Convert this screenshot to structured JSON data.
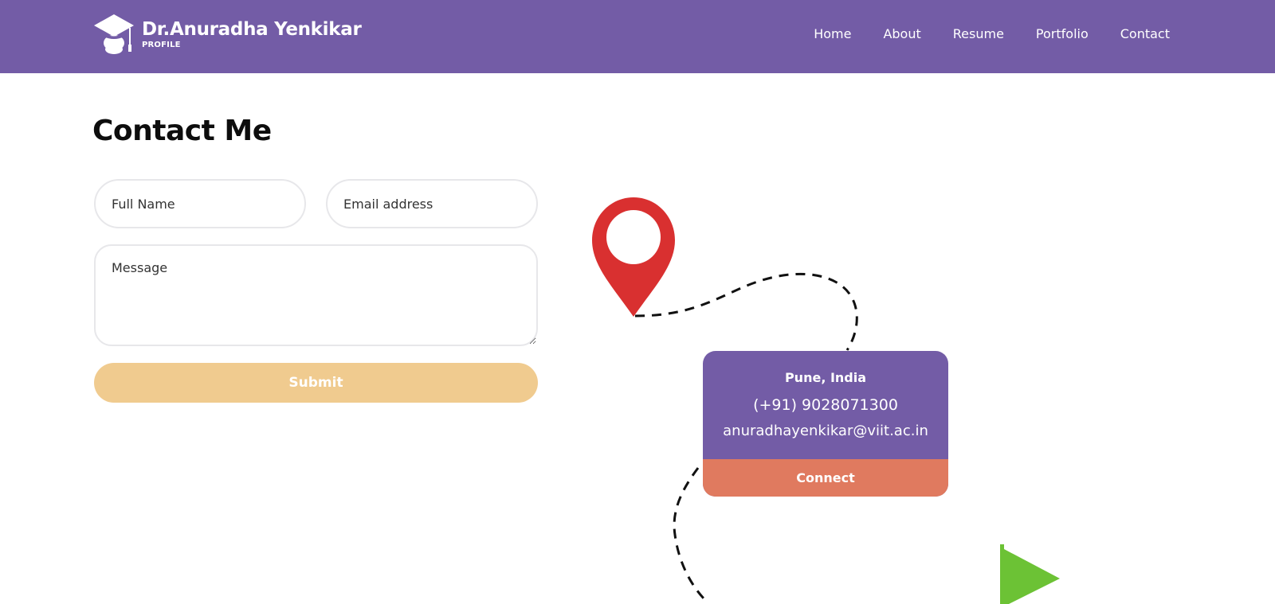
{
  "header": {
    "brand_title": "Dr.Anuradha Yenkikar",
    "brand_subtitle": "PROFILE",
    "logo_icon": "graduation-cap-icon",
    "background_color": "#735ca6",
    "nav": [
      {
        "label": "Home"
      },
      {
        "label": "About"
      },
      {
        "label": "Resume"
      },
      {
        "label": "Portfolio"
      },
      {
        "label": "Contact"
      }
    ]
  },
  "main": {
    "title": "Contact Me",
    "form": {
      "full_name_placeholder": "Full Name",
      "email_placeholder": "Email address",
      "message_placeholder": "Message",
      "submit_label": "Submit",
      "submit_color": "#f0cb8f"
    }
  },
  "contact_card": {
    "city": "Pune, India",
    "phone": "(+91) 9028071300",
    "email": "anuradhayenkikar@viit.ac.in",
    "connect_label": "Connect",
    "card_color": "#735ca6",
    "connect_color": "#e07a5f"
  },
  "illustration": {
    "pin_icon": "map-pin-icon",
    "pin_color": "#d93030",
    "flag_icon": "flag-icon",
    "flag_color": "#6cc235",
    "path": "dashed-route"
  }
}
